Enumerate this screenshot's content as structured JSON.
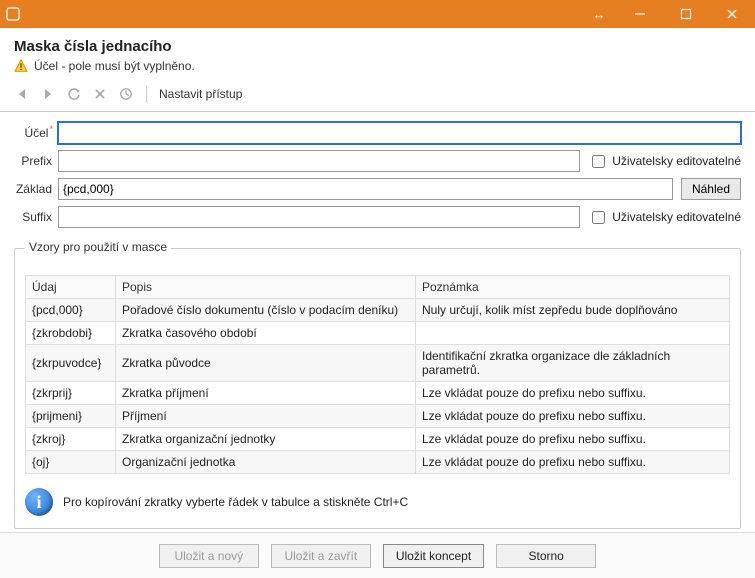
{
  "window": {
    "title": "Maska čísla jednacího",
    "warning": "Účel - pole musí být vyplněno."
  },
  "toolbar": {
    "access_label": "Nastavit přístup"
  },
  "form": {
    "ucel": {
      "label": "Účel",
      "value": ""
    },
    "prefix": {
      "label": "Prefix",
      "value": ""
    },
    "zaklad": {
      "label": "Základ",
      "value": "{pcd,000}",
      "preview_btn": "Náhled"
    },
    "suffix": {
      "label": "Suffix",
      "value": ""
    },
    "user_editable_label": "Uživatelsky editovatelné"
  },
  "patterns": {
    "title": "Vzory pro použití v masce",
    "headers": {
      "udaj": "Údaj",
      "popis": "Popis",
      "pozn": "Poznámka"
    },
    "rows": [
      {
        "udaj": "{pcd,000}",
        "popis": "Pořadové číslo dokumentu (číslo v podacím deníku)",
        "pozn": "Nuly určují, kolik míst zepředu bude doplňováno"
      },
      {
        "udaj": "{zkrobdobi}",
        "popis": "Zkratka časového období",
        "pozn": ""
      },
      {
        "udaj": "{zkrpuvodce}",
        "popis": "Zkratka původce",
        "pozn": "Identifikační zkratka organizace dle základních parametrů."
      },
      {
        "udaj": "{zkrprij}",
        "popis": "Zkratka příjmení",
        "pozn": "Lze vkládat pouze do prefixu nebo suffixu."
      },
      {
        "udaj": "{prijmeni}",
        "popis": "Příjmení",
        "pozn": "Lze vkládat pouze do prefixu nebo suffixu."
      },
      {
        "udaj": "{zkroj}",
        "popis": "Zkratka organizační jednotky",
        "pozn": "Lze vkládat pouze do prefixu nebo suffixu."
      },
      {
        "udaj": "{oj}",
        "popis": "Organizační jednotka",
        "pozn": "Lze vkládat pouze do prefixu nebo suffixu."
      }
    ],
    "info_text": "Pro kopírování zkratky vyberte řádek v tabulce a stiskněte Ctrl+C"
  },
  "footer": {
    "save_new": "Uložit a nový",
    "save_close": "Uložit a zavřít",
    "save_draft": "Uložit koncept",
    "cancel": "Storno"
  }
}
